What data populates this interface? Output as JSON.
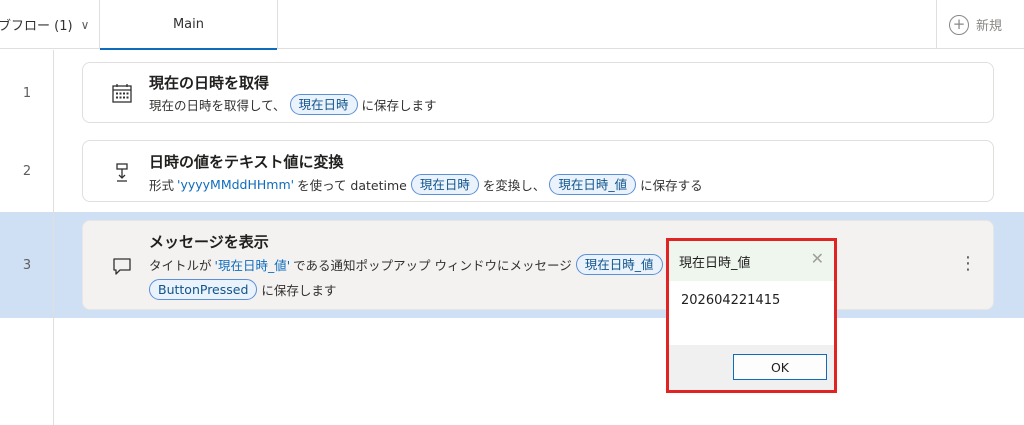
{
  "topbar": {
    "subflows_label": "ブフロー (1)",
    "main_tab": "Main",
    "new_label": "新規"
  },
  "rows": [
    {
      "number": "1",
      "title": "現在の日時を取得",
      "desc": {
        "pre": "現在の日時を取得して、",
        "var": "現在日時",
        "post": "に保存します"
      }
    },
    {
      "number": "2",
      "title": "日時の値をテキスト値に変換",
      "desc": {
        "pre": "形式",
        "format": "'yyyyMMddHHmm'",
        "mid1": "を使って datetime",
        "var1": "現在日時",
        "mid2": "を変換し、",
        "var2": "現在日時_値",
        "post": "に保存する"
      }
    },
    {
      "number": "3",
      "title": "メッセージを表示",
      "desc": {
        "pre": "タイトルが",
        "title_value": "'現在日時_値'",
        "mid": "である通知ポップアップ ウィンドウにメッセージ",
        "var": "現在日時_値",
        "line2_var": "ButtonPressed",
        "line2_post": "に保存します"
      }
    }
  ],
  "popup": {
    "title": "現在日時_値",
    "message": "202604221415",
    "ok_label": "OK"
  },
  "colors": {
    "selected_row": "#cfe0f5",
    "accent": "#0f6cbd",
    "popup_border": "#e02424"
  }
}
